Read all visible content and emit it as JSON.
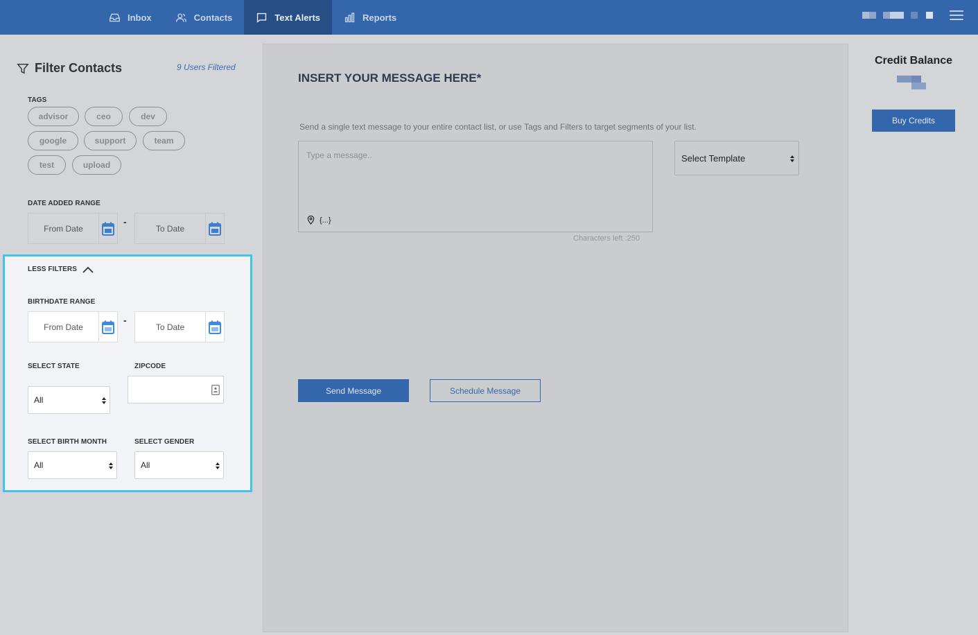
{
  "nav": {
    "items": [
      {
        "label": "Inbox",
        "icon": "inbox-icon"
      },
      {
        "label": "Contacts",
        "icon": "contacts-icon"
      },
      {
        "label": "Text Alerts",
        "icon": "chat-icon",
        "active": true
      },
      {
        "label": "Reports",
        "icon": "bar-chart-icon"
      }
    ],
    "menu_icon": "hamburger-icon"
  },
  "filters": {
    "title": "Filter Contacts",
    "users_filtered": "9 Users Filtered",
    "tags_label": "TAGS",
    "tags": [
      "advisor",
      "ceo",
      "dev",
      "google",
      "support",
      "team",
      "test",
      "upload"
    ],
    "date_added_label": "DATE ADDED RANGE",
    "from_date": "From Date",
    "to_date": "To Date",
    "range_separator": "-",
    "less_filters_label": "LESS FILTERS",
    "birthdate_label": "BIRTHDATE RANGE",
    "state_label": "SELECT STATE",
    "state_value": "All",
    "zip_label": "ZIPCODE",
    "zip_value": "",
    "birth_month_label": "SELECT BIRTH MONTH",
    "birth_month_value": "All",
    "gender_label": "SELECT GENDER",
    "gender_value": "All"
  },
  "message": {
    "title": "INSERT YOUR MESSAGE HERE*",
    "subtitle": "Send a single text message to your entire contact list, or use Tags and Filters to target segments of your list.",
    "placeholder": "Type a message..",
    "variable_token": "{...}",
    "chars_left": "Characters left :250",
    "template_select": "Select Template",
    "send_label": "Send Message",
    "schedule_label": "Schedule Message"
  },
  "credit": {
    "title": "Credit Balance",
    "buy_label": "Buy Credits"
  },
  "colors": {
    "brand": "#3466ab",
    "nav_active": "#284f85",
    "highlight": "#43c1ef",
    "link": "#3a6cb0"
  }
}
